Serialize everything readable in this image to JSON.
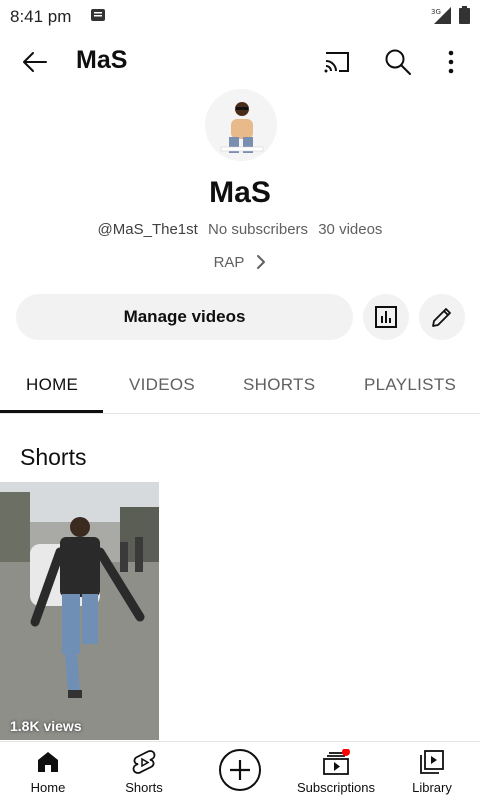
{
  "status_bar": {
    "time": "8:41 pm",
    "network": "3G",
    "icons": [
      "notification-icon",
      "signal-icon",
      "battery-icon"
    ]
  },
  "app_bar": {
    "title": "MaS",
    "icons": [
      "back-arrow-icon",
      "cast-icon",
      "search-icon",
      "more-vert-icon"
    ]
  },
  "channel": {
    "name": "MaS",
    "handle": "@MaS_The1st",
    "subscribers": "No subscribers",
    "videos": "30 videos",
    "description_link": "RAP"
  },
  "actions": {
    "manage_label": "Manage videos",
    "icons": [
      "analytics-icon",
      "edit-pencil-icon"
    ]
  },
  "tabs": [
    {
      "label": "HOME",
      "active": true
    },
    {
      "label": "VIDEOS",
      "active": false
    },
    {
      "label": "SHORTS",
      "active": false
    },
    {
      "label": "PLAYLISTS",
      "active": false
    }
  ],
  "shorts_section": {
    "title": "Shorts",
    "items": [
      {
        "views": "1.8K views"
      }
    ]
  },
  "bottom_nav": [
    {
      "label": "Home",
      "icon": "home-icon"
    },
    {
      "label": "Shorts",
      "icon": "shorts-icon"
    },
    {
      "label": "",
      "icon": "create-plus-icon"
    },
    {
      "label": "Subscriptions",
      "icon": "subscriptions-icon",
      "badge_color": "#ff0000"
    },
    {
      "label": "Library",
      "icon": "library-icon"
    }
  ]
}
